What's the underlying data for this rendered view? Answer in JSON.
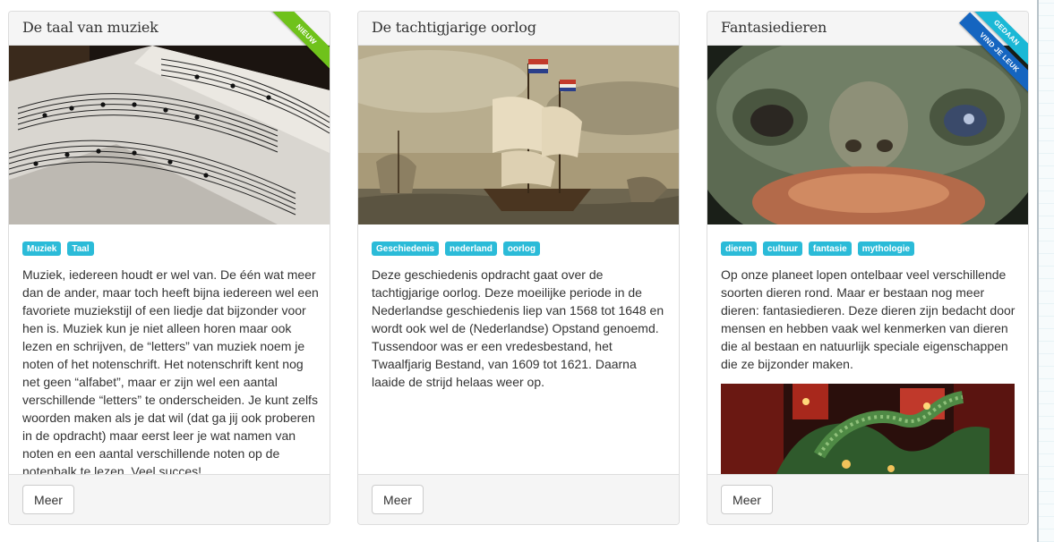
{
  "cards": [
    {
      "title": "De taal van muziek",
      "image": "sheet-music-photo",
      "tags": [
        "Muziek",
        "Taal"
      ],
      "description": "Muziek, iedereen houdt er wel van. De één wat meer dan de ander, maar toch heeft bijna iedereen wel een favoriete muziekstijl of een liedje dat bijzonder voor hen is. Muziek kun je niet alleen horen maar ook lezen en schrijven, de “letters” van muziek noem je noten of het notenschrift. Het notenschrift kent nog net geen “alfabet”, maar er zijn wel een aantal verschillende “letters” te onderscheiden. Je kunt zelfs woorden maken als je dat wil (dat ga jij ook proberen in de opdracht) maar eerst leer je wat namen van noten en een aantal verschillende noten op de notenbalk te lezen. Veel succes!",
      "ribbons": [
        {
          "label": "NIEUW",
          "color": "#6fc21b"
        }
      ],
      "button": "Meer"
    },
    {
      "title": "De tachtigjarige oorlog",
      "image": "dutch-ships-painting",
      "tags": [
        "Geschiedenis",
        "nederland",
        "oorlog"
      ],
      "description": "Deze geschiedenis opdracht gaat over de tachtigjarige oorlog. Deze moeilijke periode in de Nederlandse geschiedenis liep van 1568 tot 1648 en wordt ook wel de (Nederlandse) Opstand genoemd. Tussendoor was er een vredesbestand, het Twaalfjarig Bestand, van 1609 tot 1621. Daarna laaide de strijd helaas weer op.",
      "ribbons": [],
      "button": "Meer"
    },
    {
      "title": "Fantasiedieren",
      "image": "fantasy-creature-photo",
      "tags": [
        "dieren",
        "cultuur",
        "fantasie",
        "mythologie"
      ],
      "description": "Op onze planeet lopen ontelbaar veel verschillende soorten dieren rond. Maar er bestaan nog meer dieren: fantasiedieren. Deze dieren zijn bedacht door mensen en hebben vaak wel kenmerken van dieren die al bestaan en natuurlijk speciale eigenschappen die ze bijzonder maken.",
      "extra_image": "chinese-dragon-photo",
      "ribbons": [
        {
          "label": "GEDAAN",
          "color": "#1bb8d6"
        },
        {
          "label": "VIND JE LEUK",
          "color": "#1565c0"
        }
      ],
      "button": "Meer"
    }
  ],
  "colors": {
    "tag": "#2bbbd8",
    "panel": "#f5f5f5",
    "border": "#dddddd"
  }
}
